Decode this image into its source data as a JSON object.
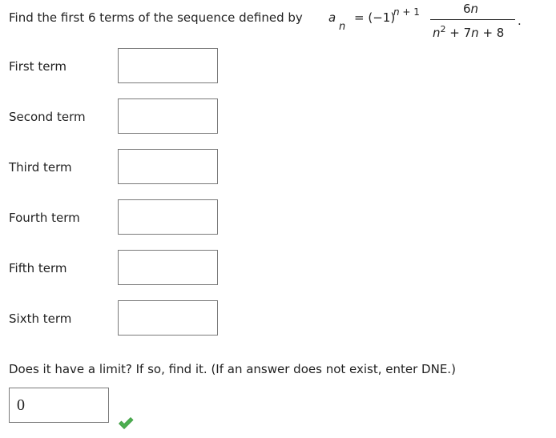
{
  "question": {
    "prefix": "Find the first 6 terms of the sequence defined by ",
    "formula": {
      "lhs_var": "a",
      "lhs_sub": "n",
      "equals": "=",
      "base": "(−1)",
      "exponent_var": "n",
      "exponent_rest": " + 1",
      "numerator_coef": "6",
      "numerator_var": "n",
      "denominator_var1": "n",
      "denominator_pow": "2",
      "denominator_mid": " + 7",
      "denominator_var2": "n",
      "denominator_end": " + 8"
    },
    "suffix": "."
  },
  "terms": [
    {
      "label": "First term",
      "value": ""
    },
    {
      "label": "Second term",
      "value": ""
    },
    {
      "label": "Third term",
      "value": ""
    },
    {
      "label": "Fourth term",
      "value": ""
    },
    {
      "label": "Fifth term",
      "value": ""
    },
    {
      "label": "Sixth term",
      "value": ""
    }
  ],
  "limit": {
    "question": "Does it have a limit? If so, find it. (If an answer does not exist, enter DNE.)",
    "value": "0",
    "status_icon": "check-icon",
    "status_color": "#4caf50"
  }
}
